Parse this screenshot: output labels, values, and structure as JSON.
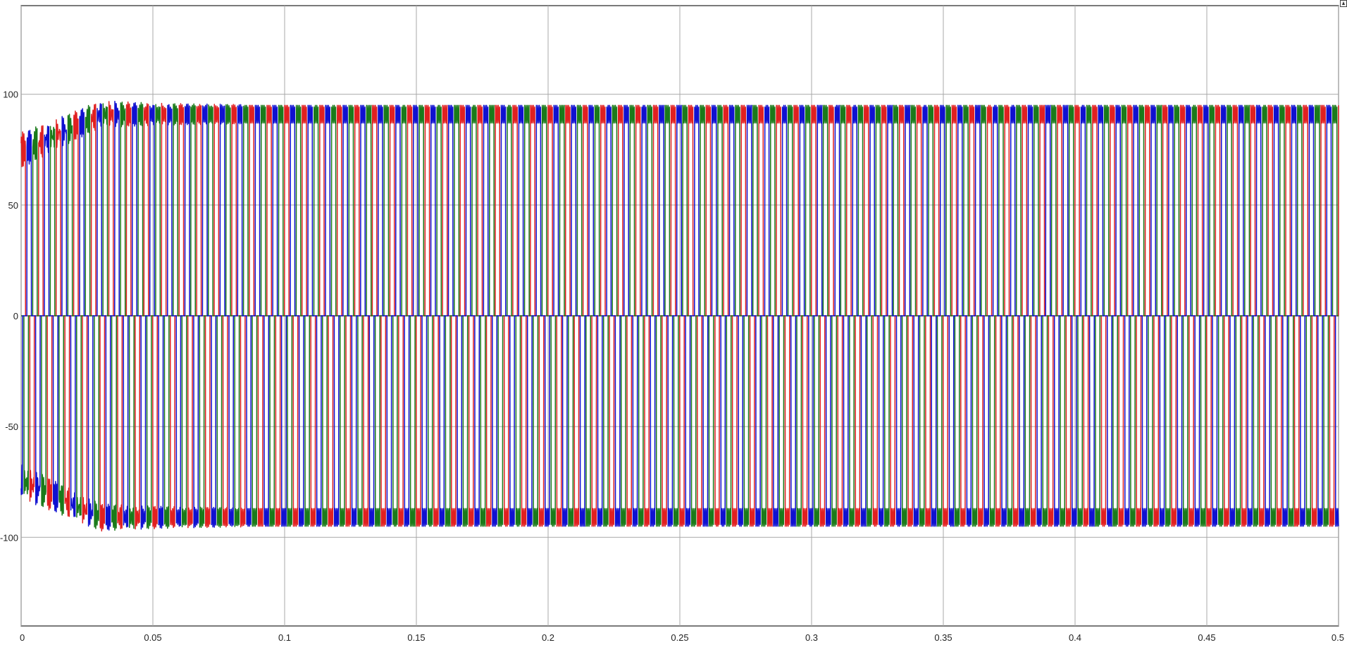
{
  "chart_data": {
    "type": "line",
    "title": "",
    "xlabel": "",
    "ylabel": "",
    "xlim": [
      0,
      0.5
    ],
    "ylim": [
      -140,
      140
    ],
    "xticks": [
      "0",
      "0.05",
      "0.1",
      "0.15",
      "0.2",
      "0.25",
      "0.3",
      "0.35",
      "0.4",
      "0.45",
      "0.5"
    ],
    "yticks": [
      "-100",
      "-50",
      "0",
      "50",
      "100"
    ],
    "grid": true,
    "waveform": {
      "fundamental_hz": 150,
      "amplitude": 93,
      "ripple": 4,
      "plateau_fraction": 0.5,
      "startup_transient_until": 0.085
    },
    "series": [
      {
        "color": "#e02020",
        "phase_deg": 0
      },
      {
        "color": "#1a7a1a",
        "phase_deg": 120
      },
      {
        "color": "#1010d0",
        "phase_deg": 240
      }
    ]
  }
}
